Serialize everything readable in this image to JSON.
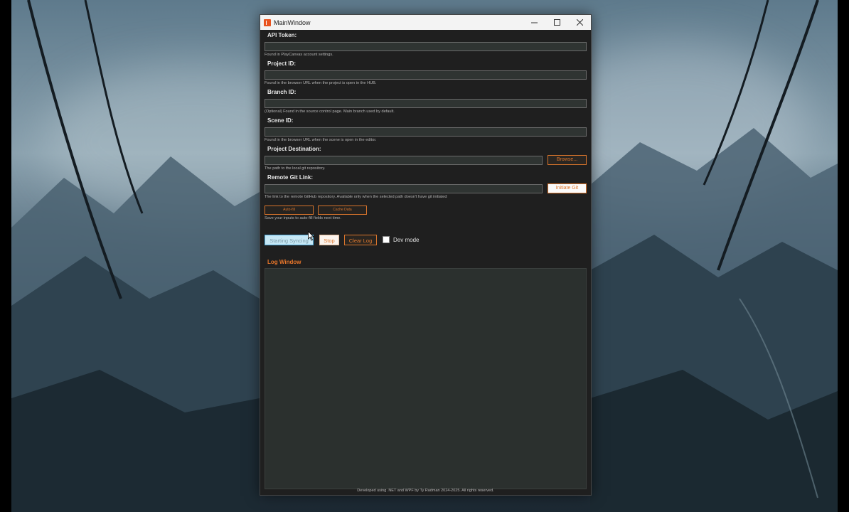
{
  "window": {
    "title": "MainWindow",
    "controls": {
      "minimize": "—",
      "maximize": "☐",
      "close": "✕"
    }
  },
  "fields": [
    {
      "label": "API Token:",
      "value": "",
      "hint": "Found in PlayCanvas account settings."
    },
    {
      "label": "Project ID:",
      "value": "",
      "hint": "Found in the browser URL when the project is open in the HUB."
    },
    {
      "label": "Branch ID:",
      "value": "",
      "hint": "(Optional) Found in the source control page. Main branch used by default."
    },
    {
      "label": "Scene ID:",
      "value": "",
      "hint": "Found in the browser URL when the scene is open in the editor."
    },
    {
      "label": "Project Destination:",
      "value": "",
      "hint": "The path to the local git repository.",
      "button": "Browse..."
    },
    {
      "label": "Remote Git Link:",
      "value": "",
      "hint": "The link to the remote GitHub repository. Available only when the selected path doesn't have git initiated",
      "button": "Initiate Git"
    }
  ],
  "autofill": {
    "auto_fill_label": "Auto-fill",
    "cache_data_label": "Cache Data",
    "hint": "Save your inputs to auto-fill fields next time."
  },
  "actions": {
    "start_label": "Starting Syncing",
    "stop_label": "Stop",
    "clear_label": "Clear Log",
    "dev_mode_label": "Dev mode",
    "dev_mode_checked": false
  },
  "log": {
    "title": "Log Window",
    "content": ""
  },
  "footer": "Developed using .NET and WPF by Ty Radman 2024-2025. All rights reserved.",
  "colors": {
    "accent": "#d8742c",
    "window_bg": "#1f1f1f",
    "input_bg": "#2f3432",
    "sync_button": "#c6e8f6"
  }
}
